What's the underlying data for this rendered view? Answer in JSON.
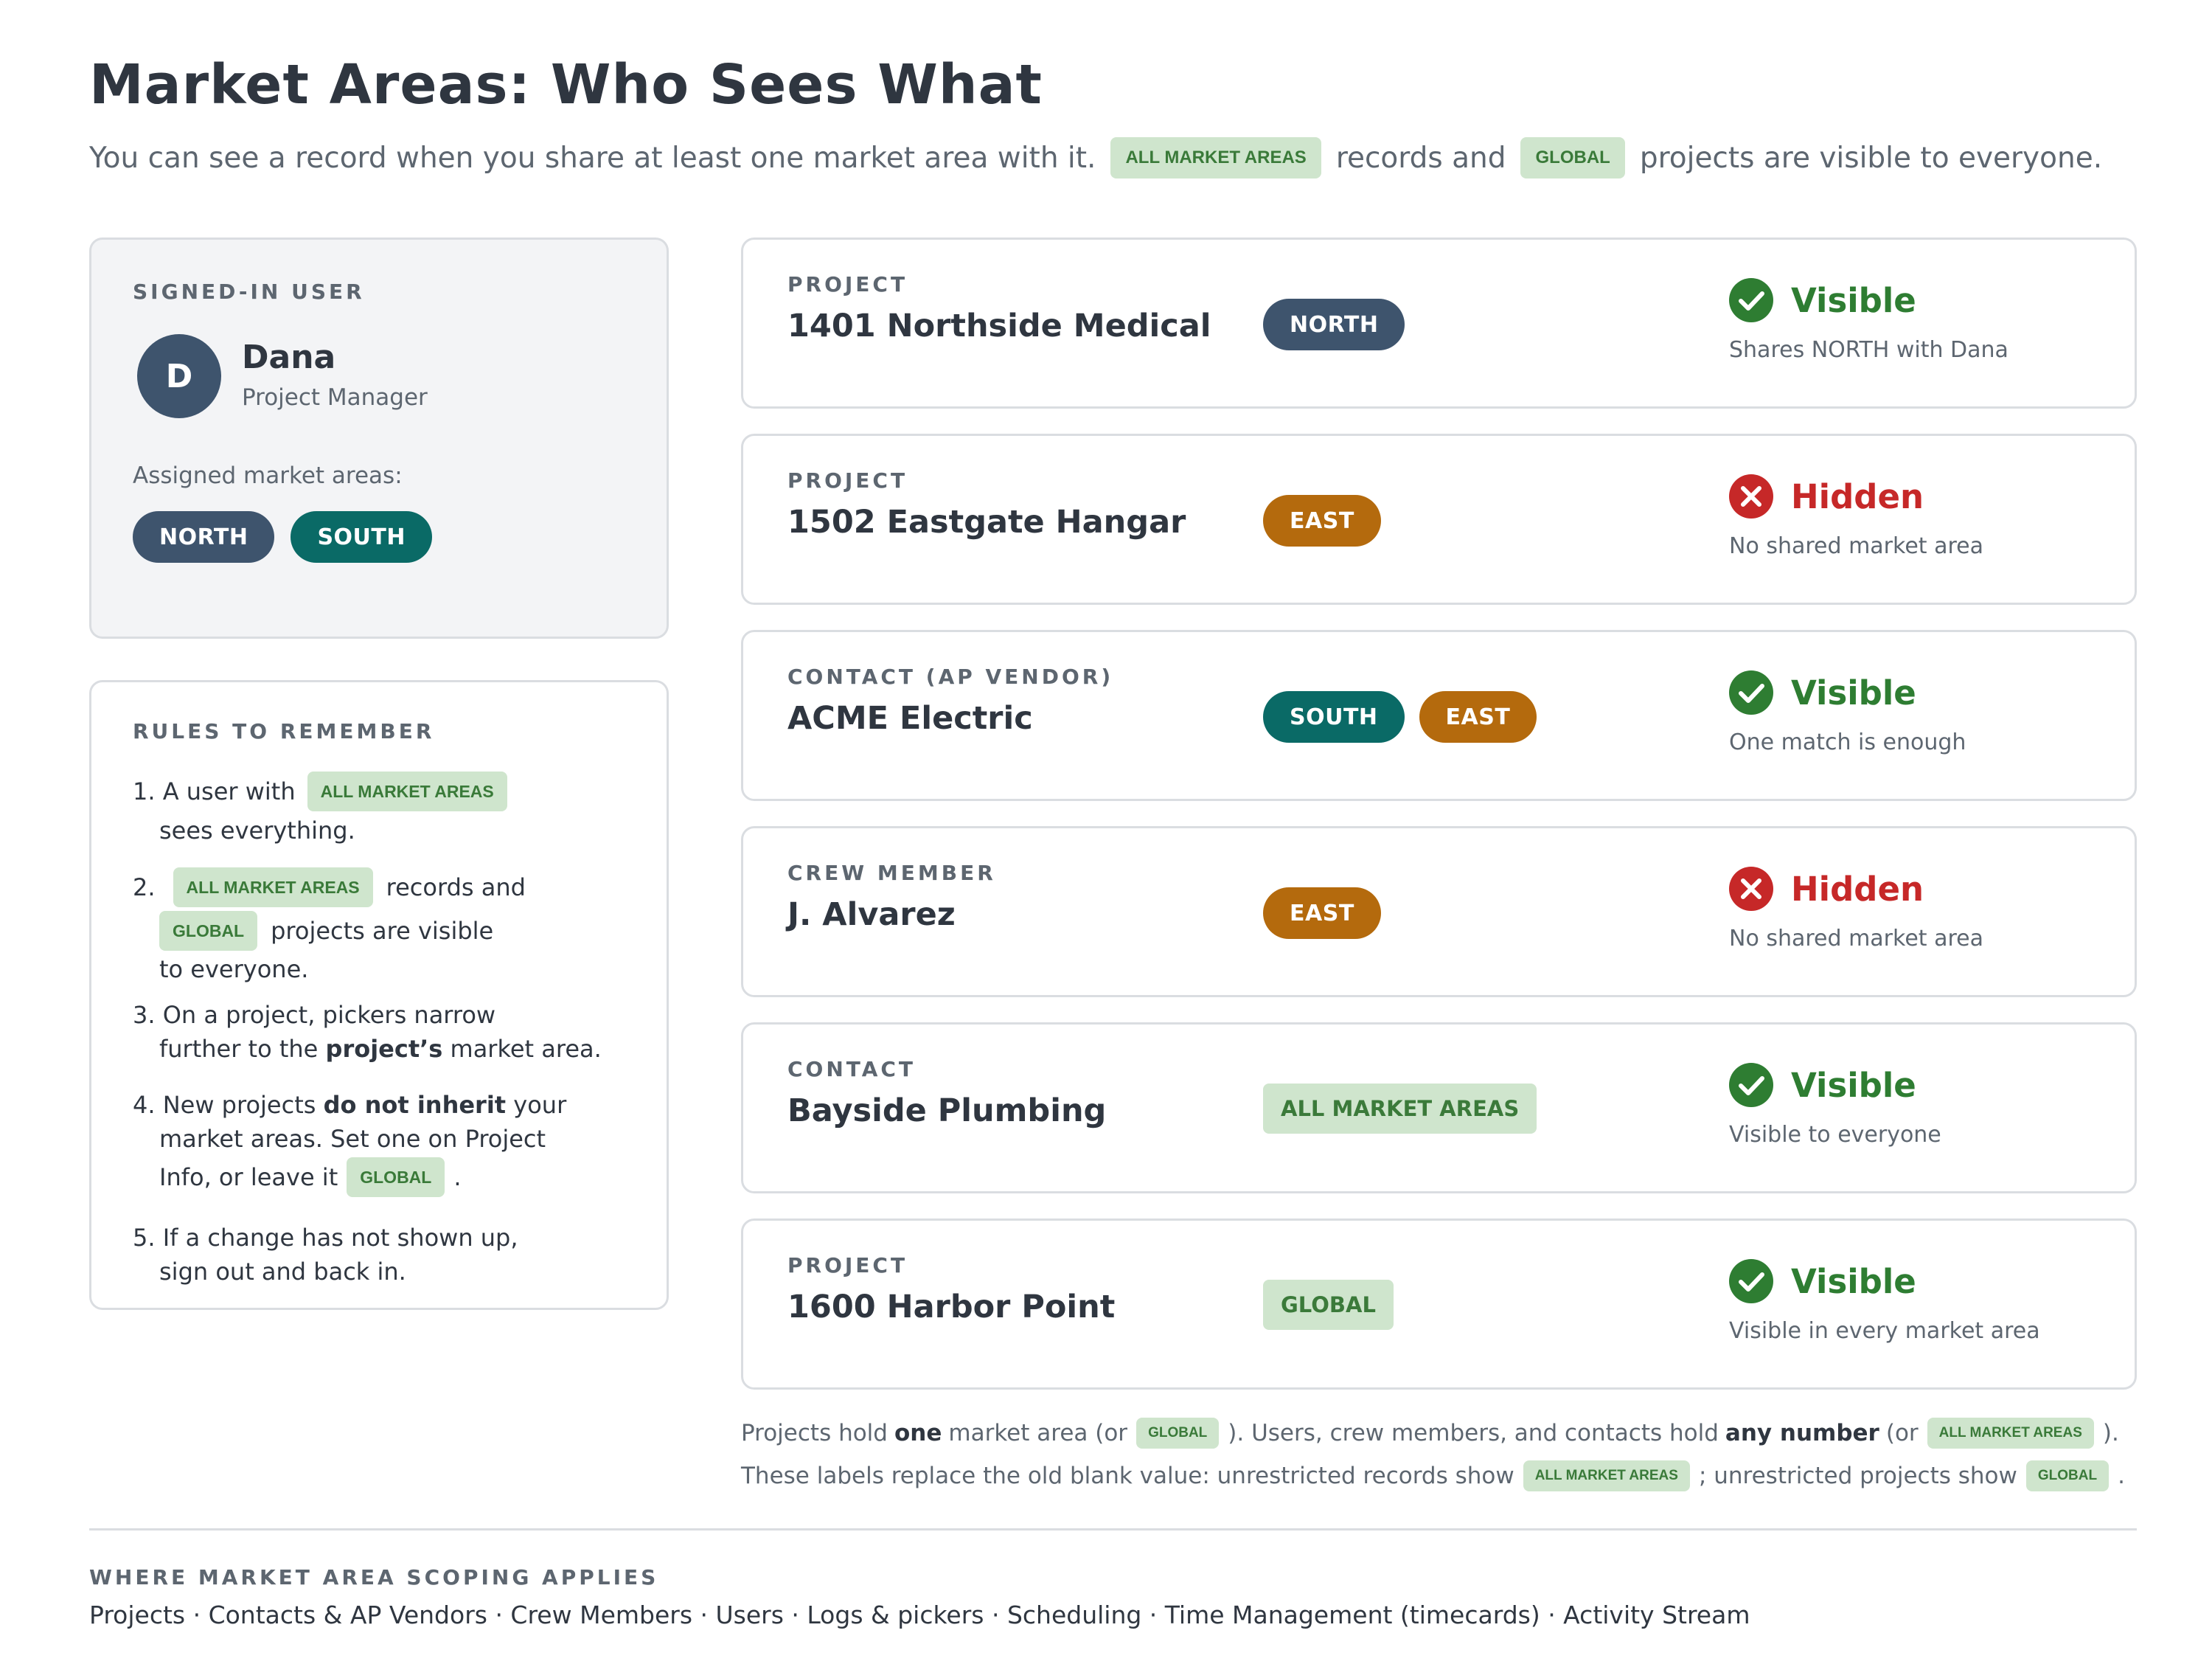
{
  "title": "Market Areas: Who Sees What",
  "subtitle": {
    "part1": "You can see a record when you share at least one market area with it.",
    "tag1": "ALL MARKET AREAS",
    "part2": "records and",
    "tag2": "GLOBAL",
    "part3": "projects are visible to everyone."
  },
  "user_panel": {
    "section_title": "SIGNED-IN USER",
    "avatar_initial": "D",
    "name": "Dana",
    "role": "Project Manager",
    "assigned_label": "Assigned market areas:",
    "areas": [
      "NORTH",
      "SOUTH"
    ]
  },
  "rules": {
    "title": "RULES TO REMEMBER",
    "r1": {
      "a": "1. A user with",
      "tag": "ALL MARKET AREAS",
      "b": "sees everything."
    },
    "r2": {
      "num": "2.",
      "tag1": "ALL MARKET AREAS",
      "a": "records and",
      "tag2": "GLOBAL",
      "b": "projects are visible",
      "c": "to everyone."
    },
    "r3": {
      "a": "3. On a project, pickers narrow",
      "b": "further to the",
      "bold": "project’s",
      "c": "market area."
    },
    "r4": {
      "a": "4. New projects",
      "bold": "do not inherit",
      "b": "your",
      "c": "market areas. Set one on Project",
      "d": "Info, or leave it",
      "tag": "GLOBAL",
      "e": "."
    },
    "r5": {
      "a": "5. If a change has not shown up,",
      "b": "sign out and back in."
    }
  },
  "records": [
    {
      "type": "PROJECT",
      "name": "1401 Northside Medical",
      "areas": [
        "NORTH"
      ],
      "status": "Visible",
      "status_icon": "check-circle-icon",
      "note": "Shares NORTH with Dana"
    },
    {
      "type": "PROJECT",
      "name": "1502 Eastgate Hangar",
      "areas": [
        "EAST"
      ],
      "status": "Hidden",
      "status_icon": "x-circle-icon",
      "note": "No shared market area"
    },
    {
      "type": "CONTACT (AP VENDOR)",
      "name": "ACME Electric",
      "areas": [
        "SOUTH",
        "EAST"
      ],
      "status": "Visible",
      "status_icon": "check-circle-icon",
      "note": "One match is enough"
    },
    {
      "type": "CREW MEMBER",
      "name": "J. Alvarez",
      "areas": [
        "EAST"
      ],
      "status": "Hidden",
      "status_icon": "x-circle-icon",
      "note": "No shared market area"
    },
    {
      "type": "CONTACT",
      "name": "Bayside Plumbing",
      "areas": [
        "ALL MARKET AREAS"
      ],
      "status": "Visible",
      "status_icon": "check-circle-icon",
      "note": "Visible to everyone"
    },
    {
      "type": "PROJECT",
      "name": "1600 Harbor Point",
      "areas": [
        "GLOBAL"
      ],
      "status": "Visible",
      "status_icon": "check-circle-icon",
      "note": "Visible in every market area"
    }
  ],
  "footnote": {
    "l1a": "Projects hold",
    "l1b": "one",
    "l1c": "market area (or",
    "l1tag1": "GLOBAL",
    "l1d": "). Users, crew members, and contacts hold",
    "l1e": "any number",
    "l1f": "(or",
    "l1tag2": "ALL MARKET AREAS",
    "l1g": ").",
    "l2a": "These labels replace the old blank value: unrestricted records show",
    "l2tag1": "ALL MARKET AREAS",
    "l2b": "; unrestricted projects show",
    "l2tag2": "GLOBAL",
    "l2c": "."
  },
  "scope": {
    "title": "WHERE MARKET AREA SCOPING APPLIES",
    "list": "Projects · Contacts & AP Vendors · Crew Members · Users · Logs & pickers · Scheduling · Time Management (timecards) · Activity Stream"
  },
  "colors": {
    "north": "#3e546d",
    "south": "#0a6a66",
    "east": "#b46a0d",
    "tag_bg": "#cfe5cd",
    "tag_text": "#3a7a39",
    "visible": "#2e7d32",
    "hidden": "#c62828"
  }
}
